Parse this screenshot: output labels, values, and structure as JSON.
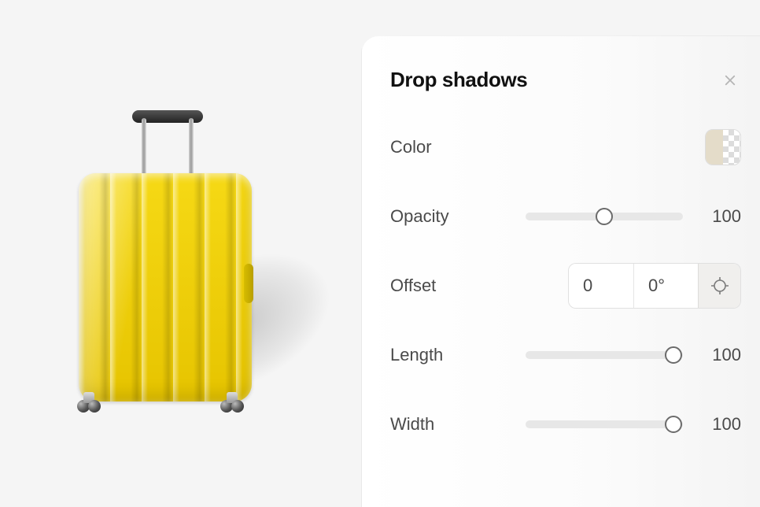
{
  "panel": {
    "title": "Drop shadows",
    "rows": {
      "color": {
        "label": "Color",
        "swatch_color": "#e4dcc9"
      },
      "opacity": {
        "label": "Opacity",
        "value": "100",
        "slider_pct": 50
      },
      "offset": {
        "label": "Offset",
        "distance": "0",
        "angle": "0°"
      },
      "length": {
        "label": "Length",
        "value": "100",
        "slider_pct": 94
      },
      "width": {
        "label": "Width",
        "value": "100",
        "slider_pct": 94
      }
    }
  },
  "preview": {
    "subject": "yellow-suitcase"
  }
}
